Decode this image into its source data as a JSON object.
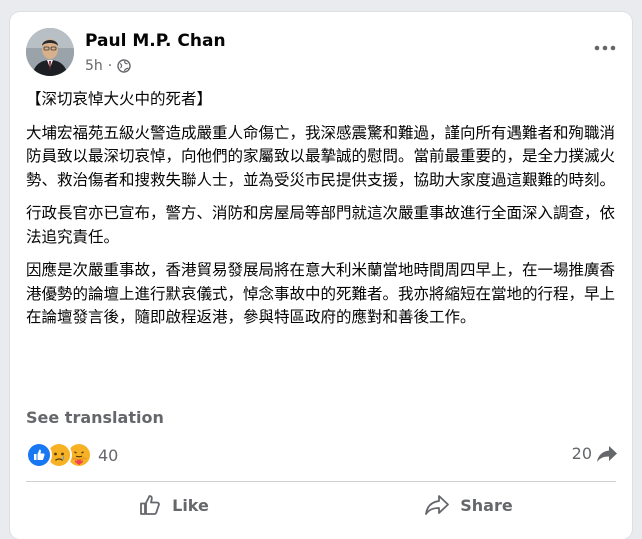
{
  "post": {
    "author": "Paul M.P. Chan",
    "time": "5h",
    "meta_separator": "·",
    "privacy_icon": "globe-icon",
    "more_icon": "more-options-icon",
    "title": "【深切哀悼大火中的死者】",
    "paragraphs": [
      "大埔宏福苑五級火警造成嚴重人命傷亡，我深感震驚和難過，謹向所有遇難者和殉職消防員致以最深切哀悼，向他們的家屬致以最摯誠的慰問。當前最重要的，是全力撲滅火勢、救治傷者和搜救失聯人士，並為受災市民提供支援，協助大家度過這艱難的時刻。",
      "行政長官亦已宣布，警方、消防和房屋局等部門就這次嚴重事故進行全面深入調查，依法追究責任。",
      "因應是次嚴重事故，香港貿易發展局將在意大利米蘭當地時間周四早上，在一場推廣香港優勢的論壇上進行默哀儀式，悼念事故中的死難者。我亦將縮短在當地的行程，早上在論壇發言後，隨即啟程返港，參與特區政府的應對和善後工作。"
    ],
    "see_translation": "See translation"
  },
  "stats": {
    "reaction_icons": [
      "like-icon",
      "sad-icon",
      "care-icon"
    ],
    "reaction_count": "40",
    "share_count": "20"
  },
  "actions": {
    "like_label": "Like",
    "share_label": "Share"
  },
  "colors": {
    "card_bg": "#ffffff",
    "page_bg": "#e9ebee",
    "text_primary": "#050505",
    "text_secondary": "#65676b",
    "like_blue": "#1877f2",
    "reaction_yellow": "#f7b125"
  }
}
